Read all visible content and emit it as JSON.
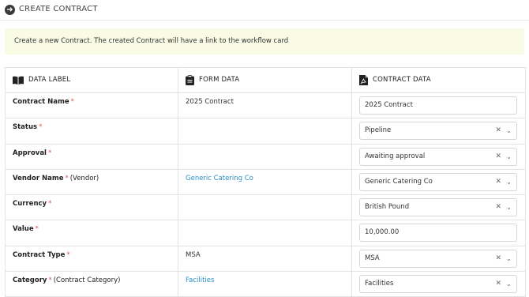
{
  "header": {
    "title": "CREATE CONTRACT"
  },
  "notice": {
    "text": "Create a new Contract. The created Contract will have a link to the workflow card"
  },
  "columns": {
    "data_label": "DATA LABEL",
    "form_data": "FORM DATA",
    "contract_data": "CONTRACT DATA"
  },
  "rows": [
    {
      "label": "Contract Name",
      "sub": "",
      "form": "2025 Contract",
      "value": "2025 Contract"
    },
    {
      "label": "Status",
      "sub": "",
      "form": "",
      "value": "Pipeline"
    },
    {
      "label": "Approval",
      "sub": "",
      "form": "",
      "value": "Awaiting approval"
    },
    {
      "label": "Vendor Name",
      "sub": "(Vendor)",
      "form": "Generic Catering Co",
      "value": "Generic Catering Co"
    },
    {
      "label": "Currency",
      "sub": "",
      "form": "",
      "value": "British Pound"
    },
    {
      "label": "Value",
      "sub": "",
      "form": "",
      "value": "10,000.00"
    },
    {
      "label": "Contract Type",
      "sub": "",
      "form": "MSA",
      "value": "MSA"
    },
    {
      "label": "Category",
      "sub": "(Contract Category)",
      "form": "Facilities",
      "value": "Facilities"
    }
  ],
  "required_marker": "*"
}
